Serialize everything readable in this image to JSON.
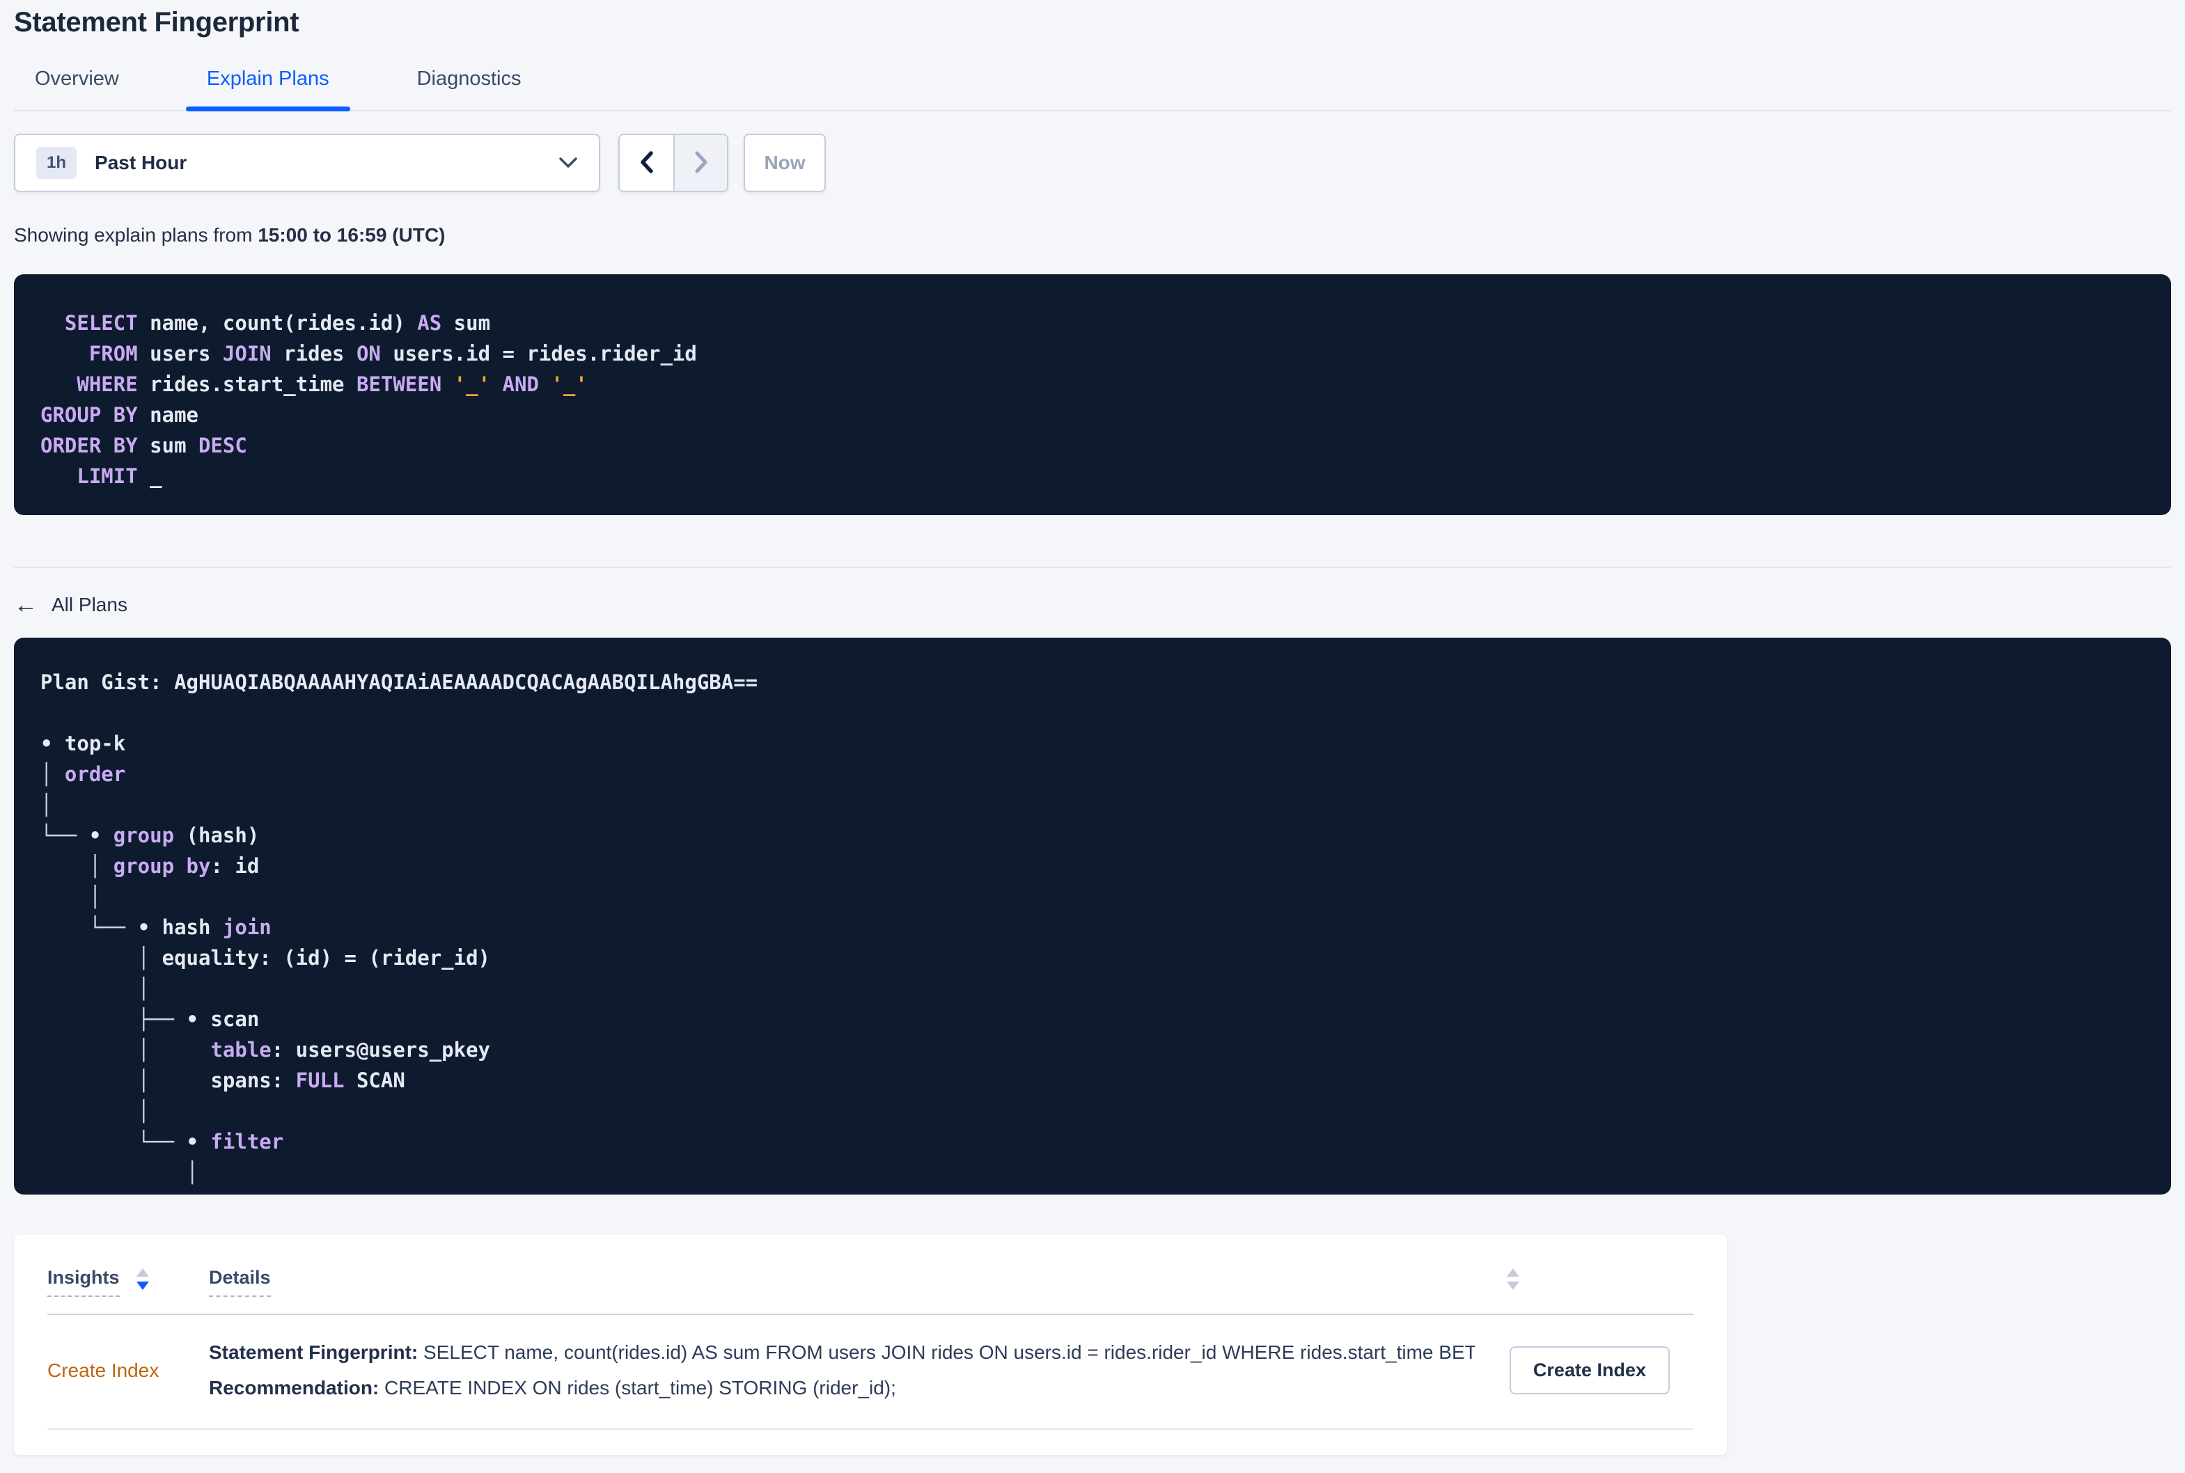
{
  "page": {
    "title": "Statement Fingerprint",
    "tabs": [
      {
        "label": "Overview",
        "active": false
      },
      {
        "label": "Explain Plans",
        "active": true
      },
      {
        "label": "Diagnostics",
        "active": false
      }
    ]
  },
  "time_picker": {
    "range_badge": "1h",
    "range_label": "Past Hour",
    "now_label": "Now",
    "showing_prefix": "Showing explain plans from ",
    "showing_range": "15:00 to 16:59 (UTC)"
  },
  "sql_statement": {
    "lines": [
      [
        {
          "c": "id",
          "t": "  "
        },
        {
          "c": "kw",
          "t": "SELECT"
        },
        {
          "c": "id",
          "t": " name, count(rides.id) "
        },
        {
          "c": "kw",
          "t": "AS"
        },
        {
          "c": "id",
          "t": " sum"
        }
      ],
      [
        {
          "c": "id",
          "t": "    "
        },
        {
          "c": "kw",
          "t": "FROM"
        },
        {
          "c": "id",
          "t": " users "
        },
        {
          "c": "kw",
          "t": "JOIN"
        },
        {
          "c": "id",
          "t": " rides "
        },
        {
          "c": "kw",
          "t": "ON"
        },
        {
          "c": "id",
          "t": " users.id = rides.rider_id"
        }
      ],
      [
        {
          "c": "id",
          "t": "   "
        },
        {
          "c": "kw",
          "t": "WHERE"
        },
        {
          "c": "id",
          "t": " rides.start_time "
        },
        {
          "c": "kw",
          "t": "BETWEEN"
        },
        {
          "c": "id",
          "t": " "
        },
        {
          "c": "ph",
          "t": "'_'"
        },
        {
          "c": "id",
          "t": " "
        },
        {
          "c": "kw",
          "t": "AND"
        },
        {
          "c": "id",
          "t": " "
        },
        {
          "c": "ph",
          "t": "'_'"
        }
      ],
      [
        {
          "c": "kw",
          "t": "GROUP BY"
        },
        {
          "c": "id",
          "t": " name"
        }
      ],
      [
        {
          "c": "kw",
          "t": "ORDER BY"
        },
        {
          "c": "id",
          "t": " sum "
        },
        {
          "c": "kw",
          "t": "DESC"
        }
      ],
      [
        {
          "c": "id",
          "t": "   "
        },
        {
          "c": "kw",
          "t": "LIMIT"
        },
        {
          "c": "id",
          "t": " _"
        }
      ]
    ]
  },
  "all_plans_label": "All Plans",
  "plan": {
    "gist_label": "Plan Gist: ",
    "gist": "AgHUAQIABQAAAAHYAQIAiAEAAAADCQACAgAABQILAhgGBA==",
    "tree": [
      [
        {
          "c": "id",
          "t": "• top-k"
        }
      ],
      [
        {
          "c": "ln",
          "t": "│ "
        },
        {
          "c": "kw",
          "t": "order"
        }
      ],
      [
        {
          "c": "ln",
          "t": "│"
        }
      ],
      [
        {
          "c": "ln",
          "t": "└── "
        },
        {
          "c": "id",
          "t": "• "
        },
        {
          "c": "kw",
          "t": "group"
        },
        {
          "c": "id",
          "t": " (hash)"
        }
      ],
      [
        {
          "c": "ln",
          "t": "    │ "
        },
        {
          "c": "kw",
          "t": "group by"
        },
        {
          "c": "id",
          "t": ": id"
        }
      ],
      [
        {
          "c": "ln",
          "t": "    │"
        }
      ],
      [
        {
          "c": "ln",
          "t": "    └── "
        },
        {
          "c": "id",
          "t": "• hash "
        },
        {
          "c": "kw",
          "t": "join"
        }
      ],
      [
        {
          "c": "ln",
          "t": "        │ "
        },
        {
          "c": "id",
          "t": "equality: (id) = (rider_id)"
        }
      ],
      [
        {
          "c": "ln",
          "t": "        │"
        }
      ],
      [
        {
          "c": "ln",
          "t": "        ├── "
        },
        {
          "c": "id",
          "t": "• scan"
        }
      ],
      [
        {
          "c": "ln",
          "t": "        │     "
        },
        {
          "c": "kw",
          "t": "table"
        },
        {
          "c": "id",
          "t": ": users@users_pkey"
        }
      ],
      [
        {
          "c": "ln",
          "t": "        │     "
        },
        {
          "c": "id",
          "t": "spans: "
        },
        {
          "c": "kw",
          "t": "FULL"
        },
        {
          "c": "id",
          "t": " SCAN"
        }
      ],
      [
        {
          "c": "ln",
          "t": "        │"
        }
      ],
      [
        {
          "c": "ln",
          "t": "        └── "
        },
        {
          "c": "id",
          "t": "• "
        },
        {
          "c": "kw",
          "t": "filter"
        }
      ],
      [
        {
          "c": "ln",
          "t": "            │"
        }
      ]
    ]
  },
  "insights_table": {
    "columns": {
      "insights": "Insights",
      "details": "Details"
    },
    "row": {
      "insight_type": "Create Index",
      "fingerprint_label": "Statement Fingerprint: ",
      "fingerprint_text": "SELECT name, count(rides.id) AS sum FROM users JOIN rides ON users.id = rides.rider_id WHERE rides.start_time BETWEEN '_…",
      "recommendation_label": "Recommendation: ",
      "recommendation_text": "CREATE INDEX ON rides (start_time) STORING (rider_id);",
      "action_label": "Create Index"
    }
  },
  "icons": {
    "select_caret": "chevron-down-icon",
    "prev": "chevron-left-icon",
    "next": "chevron-right-icon",
    "back": "arrow-left-icon",
    "sort": "sort-arrows-icon"
  },
  "colors": {
    "accent_blue": "#0b5dff",
    "panel_bg": "#0e1a2e",
    "sql_keyword": "#c9abf2",
    "sql_identifier": "#e5e9f2",
    "sql_placeholder": "#f0a33c",
    "insight_orange": "#bf6410",
    "page_bg": "#f4f6fa"
  }
}
